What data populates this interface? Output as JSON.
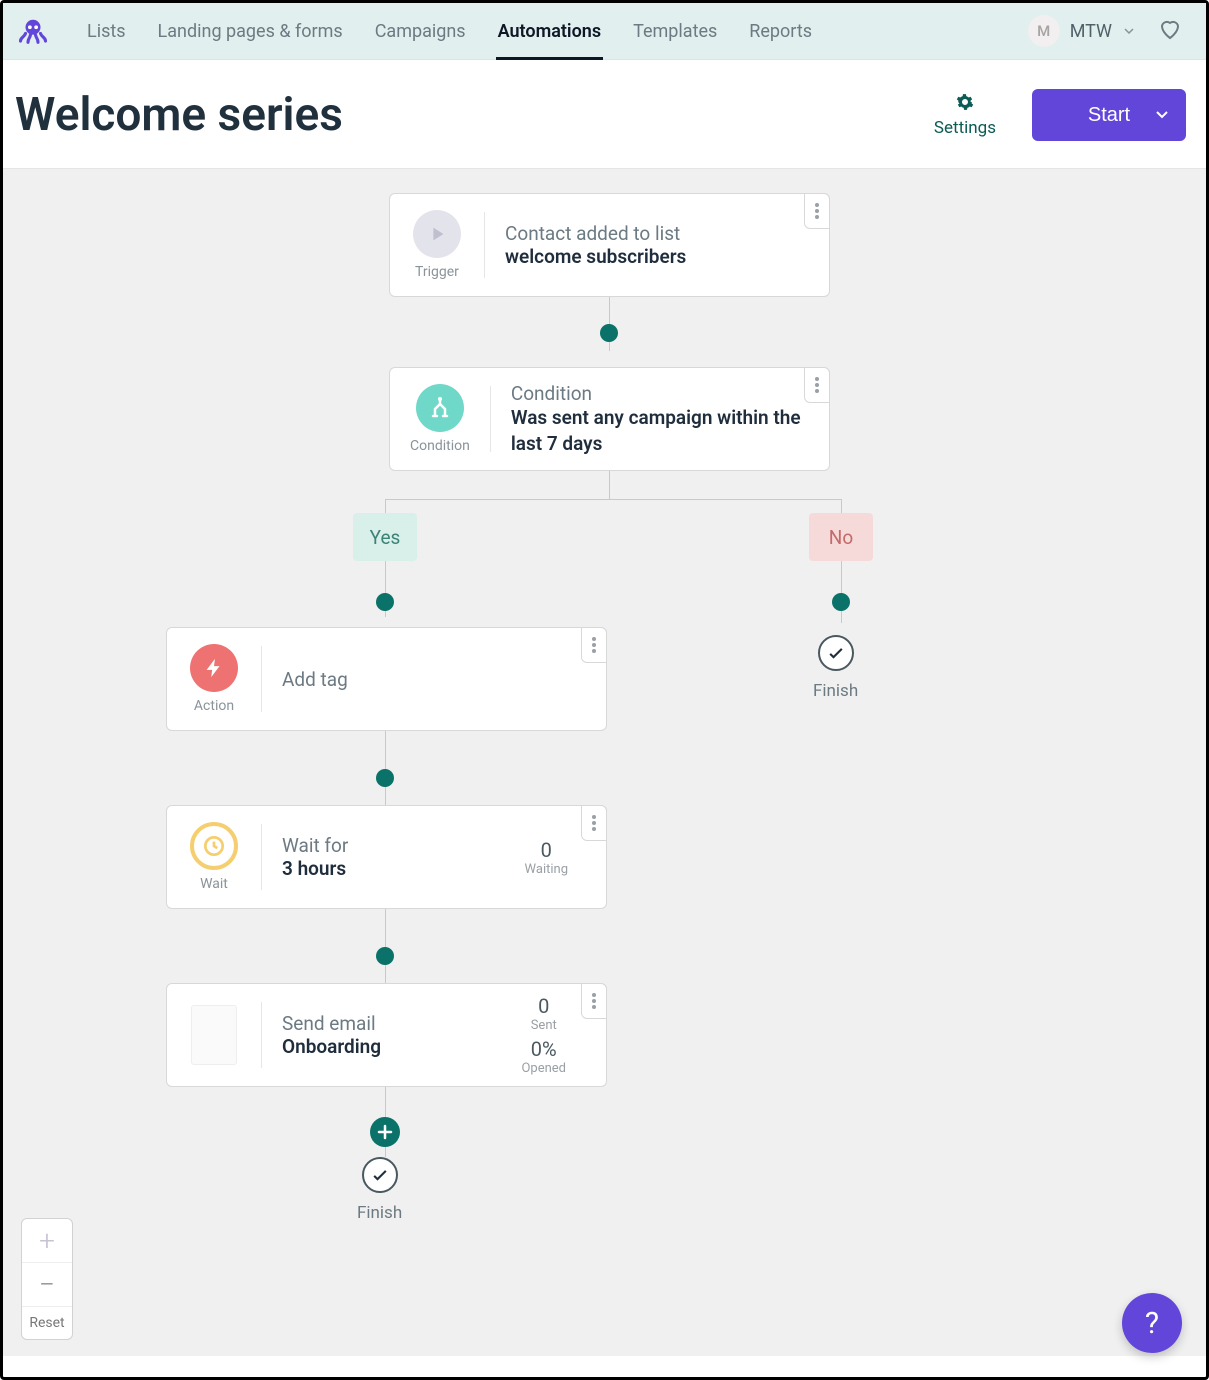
{
  "nav": {
    "items": [
      "Lists",
      "Landing pages & forms",
      "Campaigns",
      "Automations",
      "Templates",
      "Reports"
    ],
    "active_index": 3
  },
  "user": {
    "initial": "M",
    "name": "MTW"
  },
  "header": {
    "title": "Welcome series",
    "settings_label": "Settings",
    "start_label": "Start"
  },
  "flow": {
    "trigger": {
      "type_label": "Trigger",
      "line1": "Contact added to list",
      "line2": "welcome subscribers"
    },
    "condition": {
      "type_label": "Condition",
      "line1": "Condition",
      "line2": "Was sent any campaign within the last 7 days"
    },
    "branch_yes": "Yes",
    "branch_no": "No",
    "action": {
      "type_label": "Action",
      "line1": "Add tag"
    },
    "wait": {
      "type_label": "Wait",
      "line1": "Wait for",
      "line2": "3 hours",
      "stat_num": "0",
      "stat_lbl": "Waiting"
    },
    "email": {
      "line1": "Send email",
      "line2": "Onboarding",
      "sent_num": "0",
      "sent_lbl": "Sent",
      "open_num": "0%",
      "open_lbl": "Opened"
    },
    "finish_label": "Finish"
  },
  "zoom": {
    "reset": "Reset"
  },
  "help": "?"
}
